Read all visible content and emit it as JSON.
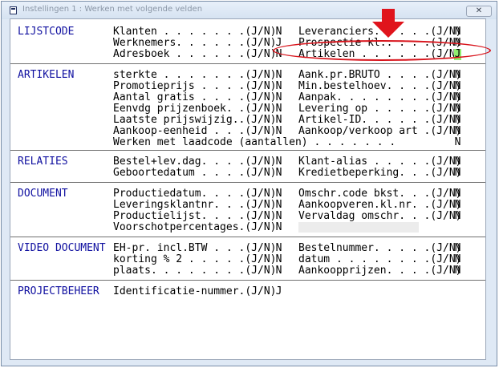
{
  "window": {
    "title": "Instellingen 1 : Werken met volgende velden",
    "close_label": "✕"
  },
  "sections": {
    "lijstcode": "LIJSTCODE",
    "artikelen": "ARTIKELEN",
    "relaties": "RELATIES",
    "document": "DOCUMENT",
    "video_document": "VIDEO DOCUMENT",
    "projectbeheer": "PROJECTBEHEER"
  },
  "fields": {
    "klanten": {
      "label": "Klanten . . . . . . .(J/N)",
      "value": "N"
    },
    "werknemers": {
      "label": "Werknemers. . . . . .(J/N)",
      "value": "J"
    },
    "adresboek": {
      "label": "Adresboek . . . . . .(J/N)",
      "value": "N"
    },
    "leveranciers": {
      "label": "Leveranciers. . . . .(J/N)",
      "value": "N"
    },
    "prospectie": {
      "label": "Prospectie kl.. . . .(J/N)",
      "value": "N"
    },
    "artikelen": {
      "label": "Artikelen . . . . . .(J/N)",
      "value": "J"
    },
    "sterkte": {
      "label": "sterkte . . . . . . .(J/N)",
      "value": "N"
    },
    "promotieprijs": {
      "label": "Promotieprijs . . . .(J/N)",
      "value": "N"
    },
    "aantal_gratis": {
      "label": "Aantal gratis . . . .(J/N)",
      "value": "N"
    },
    "eenvdg_prijzenboek": {
      "label": "Eenvdg prijzenboek. .(J/N)",
      "value": "N"
    },
    "laatste_prijswijzig": {
      "label": "Laatste prijswijzig..(J/N)",
      "value": "N"
    },
    "aankoop_eenheid": {
      "label": "Aankoop-eenheid . . .(J/N)",
      "value": "N"
    },
    "aank_pr_bruto": {
      "label": "Aank.pr.BRUTO . . . .(J/N)",
      "value": "N"
    },
    "min_bestelhoev": {
      "label": "Min.bestelhoev. . . .(J/N)",
      "value": "N"
    },
    "aanpak": {
      "label": "Aanpak. . . . . . . .(J/N)",
      "value": "N"
    },
    "levering_op": {
      "label": "Levering op . . . . .(J/N)",
      "value": "N"
    },
    "artikel_id": {
      "label": "Artikel-ID. . . . . .(J/N)",
      "value": "N"
    },
    "aankoop_verkoop_art": {
      "label": "Aankoop/verkoop art .(J/N)",
      "value": "N"
    },
    "werken_met_laadcode": {
      "label": "Werken met laadcode (aantallen) . . . . . . .",
      "value": "N"
    },
    "bestel_lev_dag": {
      "label": "Bestel+lev.dag. . . .(J/N)",
      "value": "N"
    },
    "geboortedatum": {
      "label": "Geboortedatum . . . .(J/N)",
      "value": "N"
    },
    "klant_alias": {
      "label": "Klant-alias . . . . .(J/N)",
      "value": "N"
    },
    "kredietbeperking": {
      "label": "Kredietbeperking. . .(J/N)",
      "value": "N"
    },
    "productiedatum": {
      "label": "Productiedatum. . . .(J/N)",
      "value": "N"
    },
    "leveringsklantnr": {
      "label": "Leveringsklantnr. . .(J/N)",
      "value": "N"
    },
    "productielijst": {
      "label": "Productielijst. . . .(J/N)",
      "value": "N"
    },
    "voorschotpercentages": {
      "label": "Voorschotpercentages.(J/N)",
      "value": "N"
    },
    "omschr_code_bkst": {
      "label": "Omschr.code bkst. . .(J/N)",
      "value": "N"
    },
    "aankoopveren_kl_nr": {
      "label": "Aankoopveren.kl.nr. .(J/N)",
      "value": "N"
    },
    "vervaldag_omschr": {
      "label": "Vervaldag omschr. . .(J/N)",
      "value": "N"
    },
    "eh_pr_incl_btw": {
      "label": "EH-pr. incl.BTW . . .(J/N)",
      "value": "N"
    },
    "korting_2": {
      "label": "korting % 2 . . . . .(J/N)",
      "value": "N"
    },
    "plaats": {
      "label": "plaats. . . . . . . .(J/N)",
      "value": "N"
    },
    "bestelnummer": {
      "label": "Bestelnummer. . . . .(J/N)",
      "value": "N"
    },
    "datum": {
      "label": "datum . . . . . . . .(J/N)",
      "value": "N"
    },
    "aankoopprijzen": {
      "label": "Aankoopprijzen. . . .(J/N)",
      "value": "N"
    },
    "identificatie_nummer": {
      "label": "Identificatie-nummer.(J/N)",
      "value": "J"
    }
  },
  "annotations": {
    "circle_color": "#d8141c",
    "arrow_color": "#e0141c",
    "highlight_color": "#90ee70"
  }
}
